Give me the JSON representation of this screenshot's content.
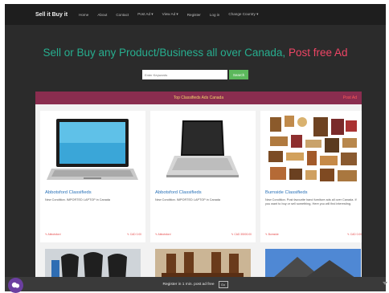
{
  "navbar": {
    "brand": "Sell it Buy it",
    "items": [
      "Home",
      "About",
      "Contact",
      "Post Ad ▾",
      "View Ad ▾",
      "Register",
      "Log in",
      "Change Country ▾"
    ]
  },
  "hero": {
    "headline": "Sell or Buy any Product/Business all over Canada,",
    "accent": "Post free Ad"
  },
  "search": {
    "placeholder": "Enter Keywords",
    "button_label": "Search"
  },
  "panel": {
    "title": "Top Classifieds Ads Canada",
    "post_link": "Post Ad"
  },
  "cards": [
    {
      "title": "Abbotsford Classifieds",
      "desc": "New Condition. IMPORTED LAPTOP in Canada",
      "location": "Abbotsford",
      "price": "CAD 0.00",
      "icon": "laptop-image"
    },
    {
      "title": "Abbotsford Classifieds",
      "desc": "New Condition. IMPORTED LAPTOP in Canada",
      "location": "Abbotsford",
      "price": "CAD 35000.00",
      "icon": "laptop-image"
    },
    {
      "title": "Burnside Classifieds",
      "desc": "New Condition. Post favourite hand furniture ads all over Canada. If you want to buy or sell something, Here you will find interesting.",
      "location": "Burnside",
      "price": "CAD 0.00",
      "icon": "furniture-image"
    }
  ],
  "bottom_bar": {
    "text": "Register in 1 min. post ad free",
    "button_label": "Go"
  },
  "colors": {
    "nav_bg": "#1e1e1e",
    "headline": "#27ae8f",
    "accent": "#ef4565",
    "panel_header": "#8a2d4f",
    "link": "#2a72b8",
    "search_button": "#5cb85c",
    "chat": "#6b3fa0"
  }
}
